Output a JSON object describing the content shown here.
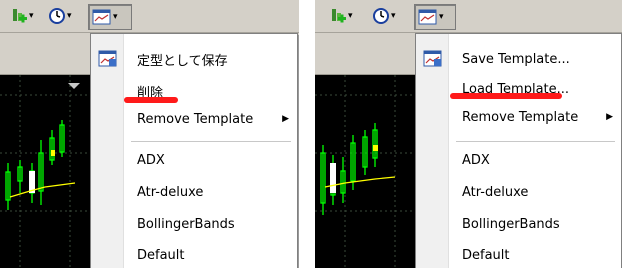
{
  "menus": {
    "left": {
      "items": [
        {
          "label": "定型として保存"
        },
        {
          "label": "削除"
        },
        {
          "label": "Remove Template"
        },
        {
          "label": "ADX"
        },
        {
          "label": "Atr-deluxe"
        },
        {
          "label": "BollingerBands"
        },
        {
          "label": "Default"
        }
      ]
    },
    "right": {
      "items": [
        {
          "label": "Save Template..."
        },
        {
          "label": "Load Template..."
        },
        {
          "label": "Remove Template"
        },
        {
          "label": "ADX"
        },
        {
          "label": "Atr-deluxe"
        },
        {
          "label": "BollingerBands"
        },
        {
          "label": "Default"
        }
      ]
    }
  },
  "icons": [
    "indicators-icon",
    "periods-icon",
    "templates-icon",
    "chevron-down-icon",
    "submenu-arrow-icon",
    "template-save-icon"
  ],
  "colors": {
    "highlight": "#ff1a1a",
    "chart_bg": "#000000",
    "candle": "#00ff00",
    "ma_line": "#ffff00"
  }
}
